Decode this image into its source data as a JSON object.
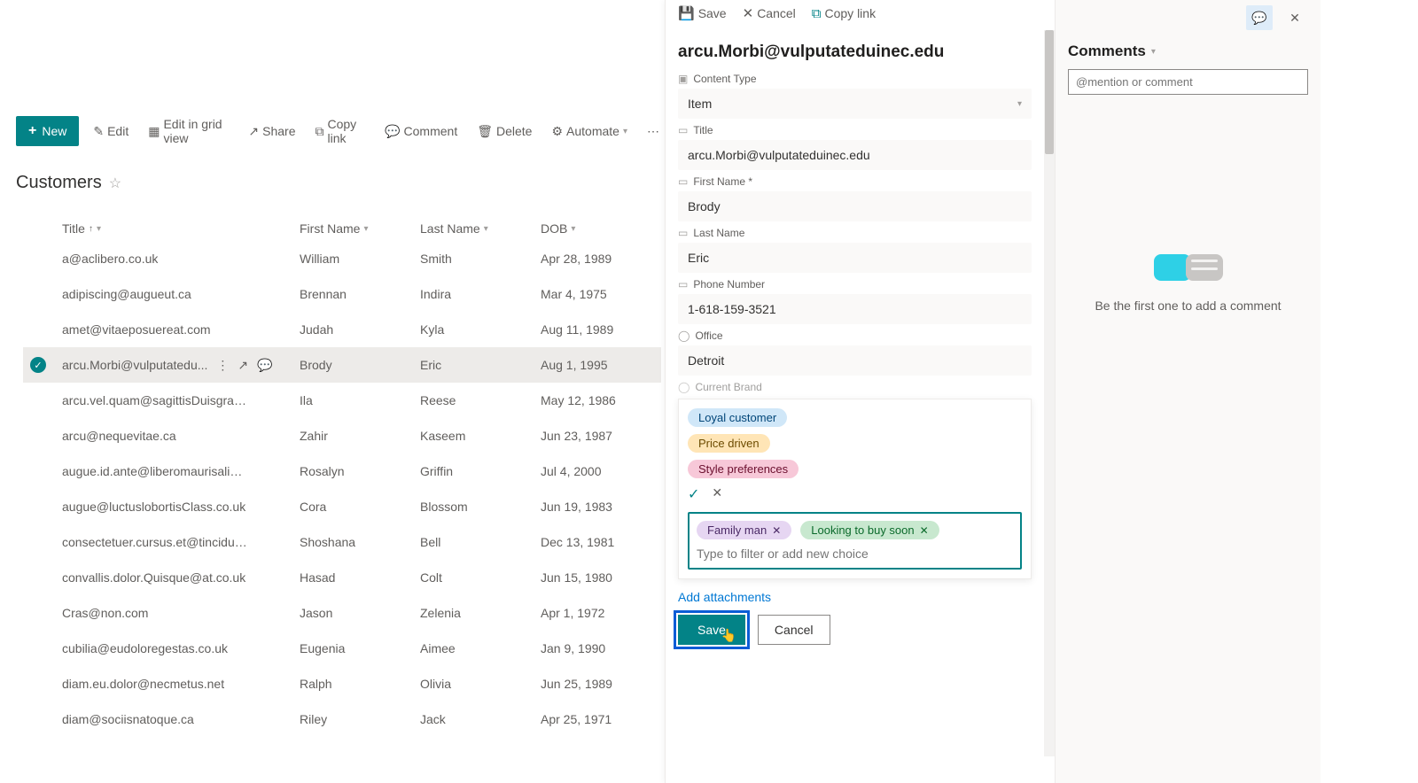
{
  "toolbar": {
    "new": "New",
    "edit": "Edit",
    "grid": "Edit in grid view",
    "share": "Share",
    "copylink": "Copy link",
    "comment": "Comment",
    "delete": "Delete",
    "automate": "Automate"
  },
  "list": {
    "title": "Customers",
    "columns": {
      "title": "Title",
      "first": "First Name",
      "last": "Last Name",
      "dob": "DOB"
    },
    "rows": [
      {
        "title": "a@aclibero.co.uk",
        "first": "William",
        "last": "Smith",
        "dob": "Apr 28, 1989"
      },
      {
        "title": "adipiscing@augueut.ca",
        "first": "Brennan",
        "last": "Indira",
        "dob": "Mar 4, 1975"
      },
      {
        "title": "amet@vitaeposuereat.com",
        "first": "Judah",
        "last": "Kyla",
        "dob": "Aug 11, 1989"
      },
      {
        "title": "arcu.Morbi@vulputatedu...",
        "first": "Brody",
        "last": "Eric",
        "dob": "Aug 1, 1995",
        "selected": true
      },
      {
        "title": "arcu.vel.quam@sagittisDuisgravida.com",
        "first": "Ila",
        "last": "Reese",
        "dob": "May 12, 1986"
      },
      {
        "title": "arcu@nequevitae.ca",
        "first": "Zahir",
        "last": "Kaseem",
        "dob": "Jun 23, 1987"
      },
      {
        "title": "augue.id.ante@liberomaurisaliquam.co.uk",
        "first": "Rosalyn",
        "last": "Griffin",
        "dob": "Jul 4, 2000"
      },
      {
        "title": "augue@luctuslobortisClass.co.uk",
        "first": "Cora",
        "last": "Blossom",
        "dob": "Jun 19, 1983"
      },
      {
        "title": "consectetuer.cursus.et@tinciduntDonec.co.uk",
        "first": "Shoshana",
        "last": "Bell",
        "dob": "Dec 13, 1981"
      },
      {
        "title": "convallis.dolor.Quisque@at.co.uk",
        "first": "Hasad",
        "last": "Colt",
        "dob": "Jun 15, 1980"
      },
      {
        "title": "Cras@non.com",
        "first": "Jason",
        "last": "Zelenia",
        "dob": "Apr 1, 1972"
      },
      {
        "title": "cubilia@eudoloregestas.co.uk",
        "first": "Eugenia",
        "last": "Aimee",
        "dob": "Jan 9, 1990"
      },
      {
        "title": "diam.eu.dolor@necmetus.net",
        "first": "Ralph",
        "last": "Olivia",
        "dob": "Jun 25, 1989"
      },
      {
        "title": "diam@sociisnatoque.ca",
        "first": "Riley",
        "last": "Jack",
        "dob": "Apr 25, 1971"
      }
    ]
  },
  "panel": {
    "toolbar": {
      "save": "Save",
      "cancel": "Cancel",
      "copylink": "Copy link"
    },
    "heading": "arcu.Morbi@vulputateduinec.edu",
    "fields": {
      "content_type_label": "Content Type",
      "content_type_value": "Item",
      "title_label": "Title",
      "title_value": "arcu.Morbi@vulputateduinec.edu",
      "first_label": "First Name *",
      "first_value": "Brody",
      "last_label": "Last Name",
      "last_value": "Eric",
      "phone_label": "Phone Number",
      "phone_value": "1-618-159-3521",
      "office_label": "Office",
      "office_value": "Detroit",
      "brand_label": "Current Brand"
    },
    "choices": {
      "opt1": "Loyal customer",
      "opt2": "Price driven",
      "opt3": "Style preferences"
    },
    "selected_tags": {
      "t1": "Family man",
      "t2": "Looking to buy soon"
    },
    "tag_placeholder": "Type to filter or add new choice",
    "add_attachments": "Add attachments",
    "save_btn": "Save",
    "cancel_btn": "Cancel"
  },
  "comments": {
    "title": "Comments",
    "placeholder": "@mention or comment",
    "empty": "Be the first one to add a comment"
  }
}
